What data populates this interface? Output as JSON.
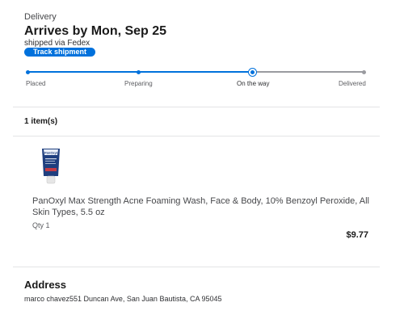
{
  "delivery": {
    "section_label": "Delivery",
    "arrives": "Arrives by Mon, Sep 25",
    "shipped": "shipped via Fedex",
    "track_button": "Track shipment",
    "accent_color": "#0071dc",
    "steps": [
      {
        "label": "Placed",
        "state": "done"
      },
      {
        "label": "Preparing",
        "state": "done"
      },
      {
        "label": "On the way",
        "state": "current"
      },
      {
        "label": "Delivered",
        "state": "pending"
      }
    ]
  },
  "items": {
    "count_label": "1 item(s)",
    "list": [
      {
        "name": "PanOxyl Max Strength Acne Foaming Wash, Face & Body, 10% Benzoyl Peroxide, All Skin Types, 5.5 oz",
        "qty": "Qty 1",
        "price": "$9.77",
        "image_icon": "product-tube-image",
        "brand": "PanOxyl"
      }
    ]
  },
  "address": {
    "title": "Address",
    "line": "marco chavez551 Duncan Ave, San Juan Bautista, CA 95045"
  }
}
